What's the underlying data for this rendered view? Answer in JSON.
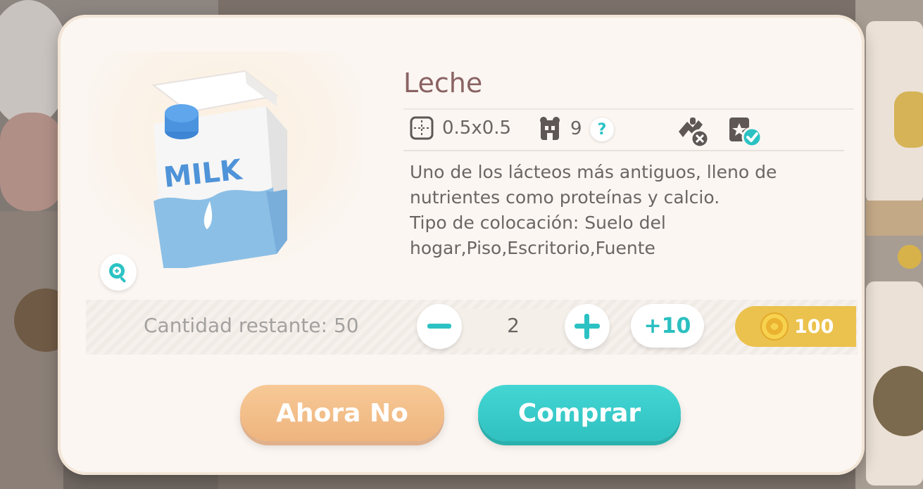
{
  "item": {
    "name": "Leche",
    "size": "0.5x0.5",
    "capacity": "9",
    "help_label": "?",
    "description_lines": [
      "Uno de los lácteos más antiguos, lleno de",
      "nutrientes como proteínas y calcio.",
      "Tipo de colocación: Suelo del",
      "hogar,Piso,Escritorio,Fuente"
    ],
    "carton_text": "MILK"
  },
  "purchase": {
    "remaining_label": "Cantidad restante: 50",
    "quantity": "2",
    "plus_ten_label": "+10",
    "price": "100"
  },
  "buttons": {
    "cancel": "Ahora No",
    "buy": "Comprar"
  },
  "colors": {
    "accent_teal": "#2cc2c3",
    "cancel_orange": "#f2bc88",
    "coin_gold": "#ebc24d",
    "title_color": "#8a6363"
  },
  "icons": [
    "zoom-icon",
    "size-grid-icon",
    "people-icon",
    "help-icon",
    "no-interaction-icon",
    "collection-check-icon",
    "minus-icon",
    "plus-icon",
    "coin-icon"
  ]
}
